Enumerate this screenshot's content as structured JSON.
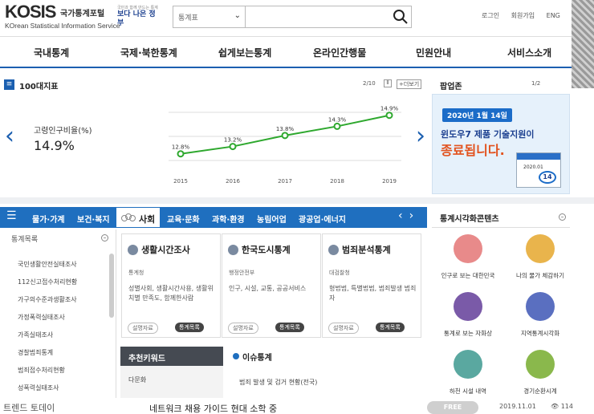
{
  "header": {
    "logo": "KOSIS",
    "logo_kr": "국가통계포털",
    "logo_sub": "KOrean Statistical Information Service",
    "slogan_small": "국민과 함께 만드는 통계",
    "slogan": "보다 나은 정부",
    "search_category": "통계표",
    "search_placeholder": "",
    "util_links": [
      "로그인",
      "회원가입",
      "ENG"
    ]
  },
  "nav": [
    "국내통계",
    "국제·북한통계",
    "쉽게보는통계",
    "온라인간행물",
    "민원안내",
    "서비스소개"
  ],
  "indicator": {
    "title": "100대지표",
    "page": "2/10",
    "more_label": "+더보기",
    "label": "고령인구비율(%)",
    "value": "14.9%",
    "chart_data": {
      "type": "line",
      "x": [
        "2015",
        "2016",
        "2017",
        "2018",
        "2019"
      ],
      "values": [
        12.8,
        13.2,
        13.8,
        14.3,
        14.9
      ],
      "labels": [
        "12.8%",
        "13.2%",
        "13.8%",
        "14.3%",
        "14.9%"
      ],
      "ylim": [
        12,
        15.5
      ],
      "color": "#2ea82e"
    }
  },
  "popup": {
    "title": "팝업존",
    "page": "1/2",
    "date": "2020년 1월 14일",
    "line1": "윈도우7 제품 기술지원이",
    "line2": "종료됩니다.",
    "cal_date": "2020.01",
    "cal_day": "14"
  },
  "categories": {
    "tabs": [
      "물가·가계",
      "보건·복지",
      "사회",
      "교육·문화",
      "과학·환경",
      "농림어업",
      "광공업·에너지"
    ],
    "active": "사회"
  },
  "stat_list": {
    "title": "통계목록",
    "items": [
      "국민생활안전실태조사",
      "112신고접수처리현황",
      "가구의수준과생활조사",
      "가정폭력실태조사",
      "가족실태조사",
      "경찰범죄통계",
      "범죄접수처리현황",
      "성폭력실태조사"
    ]
  },
  "cards": [
    {
      "title": "생활시간조사",
      "dept": "통계청",
      "desc": "성별사회, 생활시간사용, 생활위치별 만족도, 함께한사람",
      "b1": "설명자료",
      "b2": "통계목록"
    },
    {
      "title": "한국도시통계",
      "dept": "행정안전부",
      "desc": "인구, 시설, 교통, 공공서비스",
      "b1": "설명자료",
      "b2": "통계목록"
    },
    {
      "title": "범죄분석통계",
      "dept": "대검찰청",
      "desc": "형법범, 특별법범, 범죄발생 범죄자",
      "b1": "설명자료",
      "b2": "통계목록"
    }
  ],
  "keywords": {
    "title": "추천키워드",
    "items": [
      "다문화"
    ]
  },
  "news": {
    "title": "이슈통계",
    "item": "범죄 발생 및 검거 현황(전국)"
  },
  "visual": {
    "title": "통계시각화콘텐츠",
    "items": [
      {
        "label": "인구로 보는 대한민국",
        "color": "#e88a8a"
      },
      {
        "label": "나의 물가 체감하기",
        "color": "#e9b44c"
      },
      {
        "label": "통계로 보는 자화상",
        "color": "#7a5aa8"
      },
      {
        "label": "지역통계시각화",
        "color": "#5a6fc0"
      },
      {
        "label": "하천 시설 내역",
        "color": "#5aa8a0"
      },
      {
        "label": "경기순환시계",
        "color": "#8ab84c"
      }
    ]
  },
  "footer": {
    "left": "트렌드 토데이",
    "middle": "네트워크 채용 가이드 현대 소학 중",
    "free": "FREE",
    "date": "2019.11.01",
    "views": "114"
  }
}
